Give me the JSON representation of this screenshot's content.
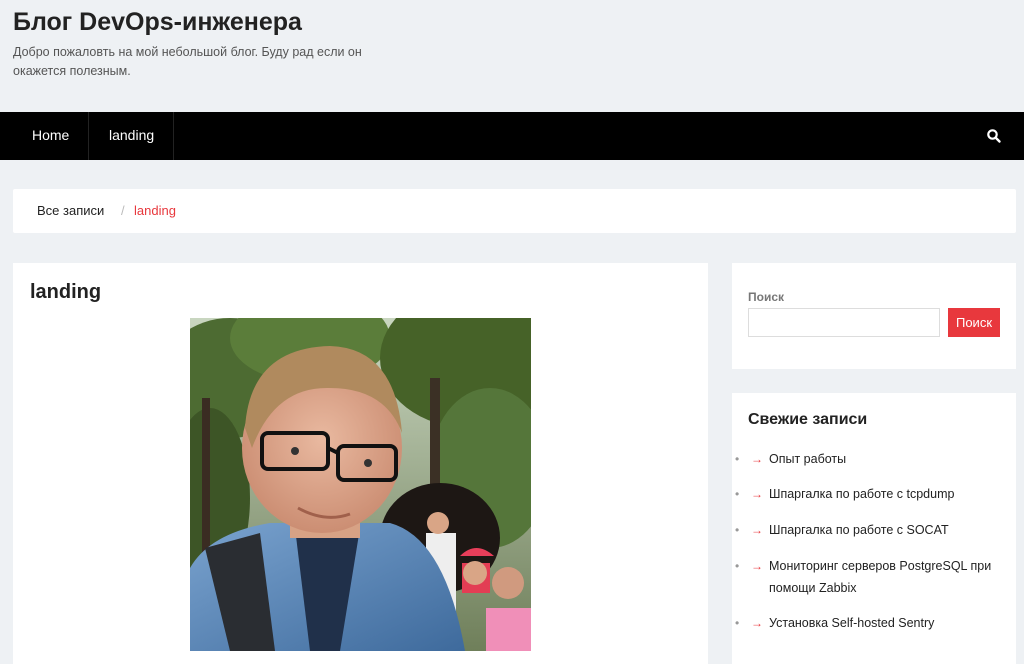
{
  "header": {
    "title": "Блог DevOps-инженера",
    "description": "Добро пожаловть на мой небольшой блог. Буду рад если он окажется полезным."
  },
  "nav": {
    "items": [
      {
        "label": "Home"
      },
      {
        "label": "landing"
      }
    ],
    "search_icon": "search-icon"
  },
  "breadcrumb": {
    "home": "Все записи",
    "separator": "/",
    "current": "landing"
  },
  "main": {
    "title": "landing",
    "image": "portrait-photo"
  },
  "search_widget": {
    "label": "Поиск",
    "placeholder": "",
    "button": "Поиск"
  },
  "recent_widget": {
    "title": "Свежие записи",
    "bullet": "•",
    "arrow": "→",
    "items": [
      {
        "label": "Опыт работы"
      },
      {
        "label": "Шпаргалка по работе с tcpdump"
      },
      {
        "label": "Шпаргалка по работе с SOCAT"
      },
      {
        "label": "Мониторинг серверов PostgreSQL при помощи Zabbix"
      },
      {
        "label": "Установка Self-hosted Sentry"
      }
    ]
  },
  "colors": {
    "accent": "#e8383d",
    "nav_bg": "#000000",
    "page_bg": "#eef1f4"
  }
}
